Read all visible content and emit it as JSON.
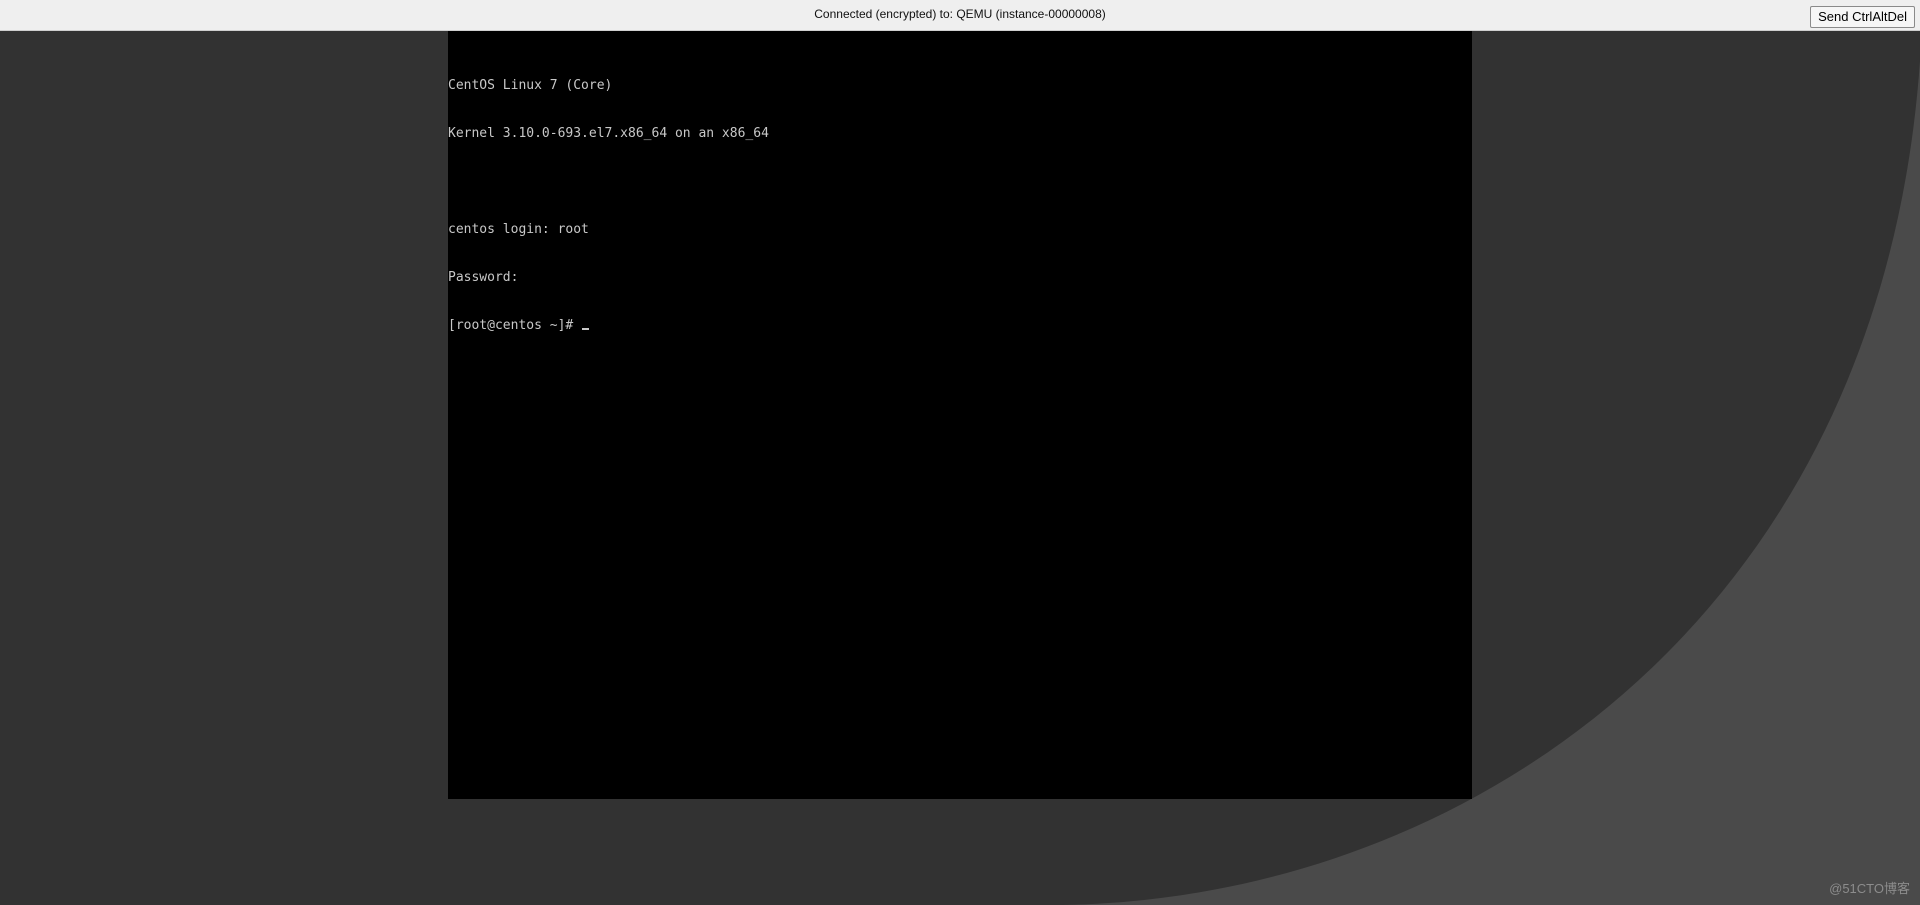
{
  "status_bar": {
    "connection_text": "Connected (encrypted) to: QEMU (instance-00000008)",
    "ctrl_alt_del_label": "Send CtrlAltDel"
  },
  "console": {
    "lines": [
      "CentOS Linux 7 (Core)",
      "Kernel 3.10.0-693.el7.x86_64 on an x86_64",
      "",
      "centos login: root",
      "Password:",
      "[root@centos ~]# "
    ],
    "cursor": "underscore"
  },
  "watermark": "@51CTO博客",
  "colors": {
    "background": "#323232",
    "background_curve": "#4a4a4a",
    "topbar": "#efefef",
    "console_bg": "#000000",
    "console_text": "#c8c8c8"
  }
}
